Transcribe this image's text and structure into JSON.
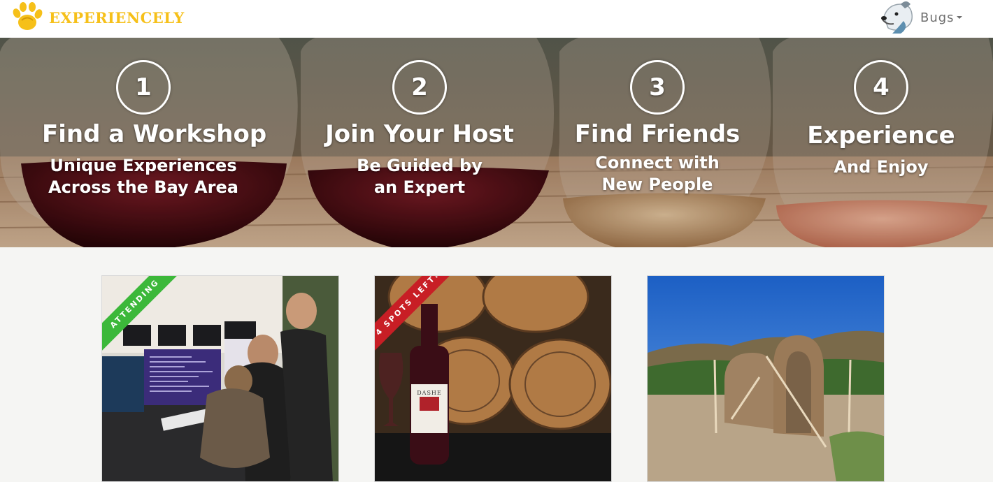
{
  "header": {
    "brand": "EXPERIENCELY",
    "logo_icon": "paw-icon",
    "user_name": "Bugs",
    "avatar_icon": "dog-avatar-icon",
    "brand_color": "#f6c019"
  },
  "hero": {
    "steps": [
      {
        "number": "1",
        "title": "Find a Workshop",
        "line1": "Unique Experiences",
        "line2": "Across the Bay Area"
      },
      {
        "number": "2",
        "title": "Join Your Host",
        "line1": "Be Guided by",
        "line2": "an Expert"
      },
      {
        "number": "3",
        "title": "Find Friends",
        "line1": "Connect with",
        "line2": "New People"
      },
      {
        "number": "4",
        "title": "Experience",
        "line1": "And Enjoy",
        "line2": ""
      }
    ]
  },
  "cards": [
    {
      "ribbon": "Attending",
      "ribbon_color": "#3cb83a"
    },
    {
      "ribbon": "4 Spots Left!",
      "ribbon_color": "#c81e25",
      "label_text": "DASHE"
    },
    {
      "ribbon": ""
    }
  ]
}
